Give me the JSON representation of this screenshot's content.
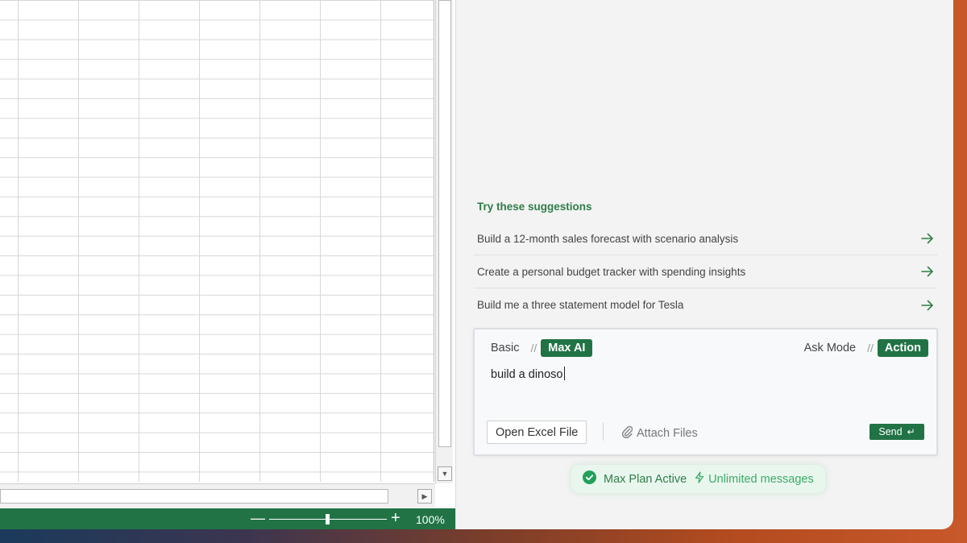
{
  "spreadsheet": {
    "zoom_minus": "—",
    "zoom_plus": "+",
    "zoom_level": "100%"
  },
  "panel": {
    "suggestions_title": "Try these suggestions",
    "suggestions": [
      {
        "label": "Build a 12-month sales forecast with scenario analysis"
      },
      {
        "label": "Create a personal budget tracker with spending insights"
      },
      {
        "label": "Build me a three statement model for Tesla"
      }
    ],
    "composer": {
      "model_basic": "Basic",
      "model_separator": "//",
      "model_max": "Max AI",
      "mode_ask": "Ask Mode",
      "mode_separator": "//",
      "mode_action": "Action",
      "input_value": "build a dinoso",
      "open_file_label": "Open Excel File",
      "attach_label": "Attach Files",
      "send_label": "Send",
      "send_glyph": "↵"
    },
    "plan": {
      "label": "Max Plan Active",
      "sub": "Unlimited messages"
    }
  },
  "colors": {
    "accent": "#217346",
    "suggestion_heading": "#2f7d48",
    "plan_bg": "#e9f6ee"
  },
  "icons": {
    "suggestion_arrow": "arrow-right-icon",
    "attach": "paperclip-icon",
    "plan_check": "check-circle-icon",
    "plan_bolt": "lightning-icon"
  }
}
